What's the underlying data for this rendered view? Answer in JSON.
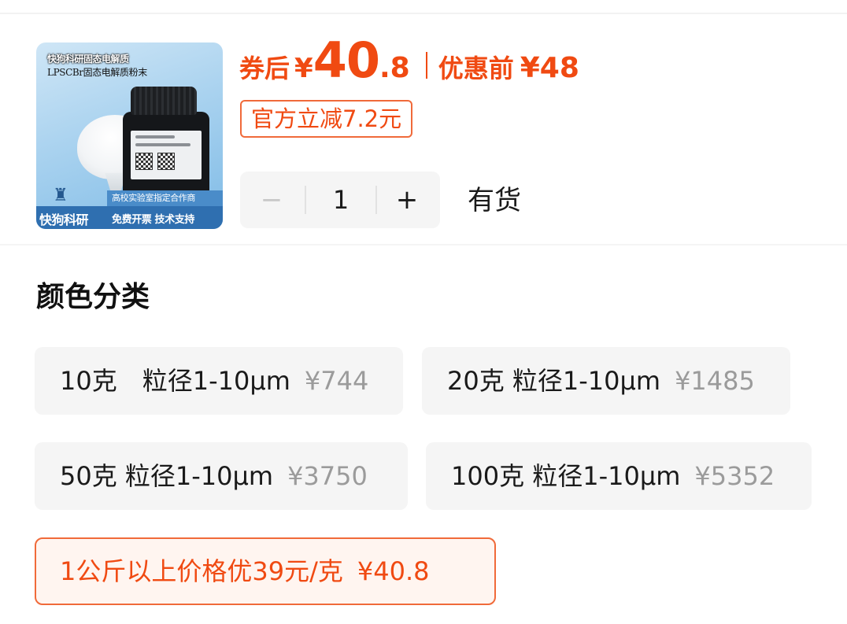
{
  "product_image": {
    "line1": "快狗科研固态电解质",
    "line2": "LPSCBr固态电解质粉末",
    "banner_top": "高校实验室指定合作商",
    "brand": "快狗科研",
    "brand_sub": "免费开票 技术支持"
  },
  "price": {
    "after_label": "券后",
    "currency": "¥",
    "after_int": "40",
    "after_dec": ".8",
    "before_label": "优惠前",
    "before_value": "¥48",
    "discount_tag": "官方立减7.2元"
  },
  "quantity": {
    "minus": "−",
    "value": "1",
    "plus": "+",
    "stock": "有货"
  },
  "section": {
    "title": "颜色分类"
  },
  "options": [
    {
      "label": "10克　粒径1-10μm",
      "price": "¥744",
      "selected": false
    },
    {
      "label": "20克 粒径1-10μm",
      "price": "¥1485",
      "selected": false
    },
    {
      "label": "50克 粒径1-10μm",
      "price": "¥3750",
      "selected": false
    },
    {
      "label": "100克 粒径1-10μm",
      "price": "¥5352",
      "selected": false
    },
    {
      "label": "1公斤以上价格优39元/克",
      "price": "¥40.8",
      "selected": true
    }
  ],
  "colors": {
    "accent": "#f04a12",
    "option_bg": "#f5f5f5",
    "muted_price": "#9b9b9b"
  }
}
